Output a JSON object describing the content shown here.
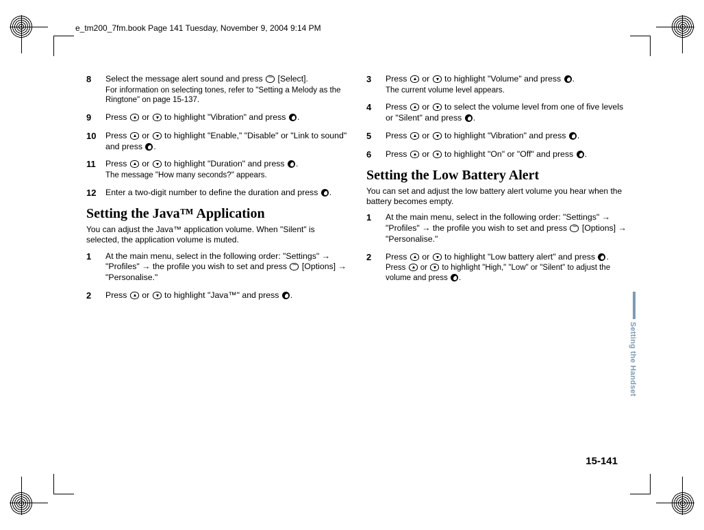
{
  "doc_header": "e_tm200_7fm.book  Page 141  Tuesday, November 9, 2004  9:14 PM",
  "side_tab": "Setting the Handset",
  "page_number": "15-141",
  "left": {
    "steps_a": [
      {
        "n": "8",
        "text_a": "Select the message alert sound and press ",
        "text_b": " [Select].",
        "sub": "For information on selecting tones, refer to \"Setting a Melody as the Ringtone\" on page 15-137."
      },
      {
        "n": "9",
        "text_a": "Press ",
        "mid": " or ",
        "text_b": " to highlight \"Vibration\" and press ",
        "text_c": "."
      },
      {
        "n": "10",
        "text_a": "Press ",
        "mid": " or ",
        "text_b": " to highlight \"Enable,\" \"Disable\" or \"Link to sound\" and press ",
        "text_c": "."
      },
      {
        "n": "11",
        "text_a": "Press ",
        "mid": " or ",
        "text_b": " to highlight \"Duration\" and press ",
        "text_c": ".",
        "sub": "The message \"How many seconds?\" appears."
      },
      {
        "n": "12",
        "text_a": "Enter a two-digit number to define the duration and press ",
        "text_c": "."
      }
    ],
    "heading": "Setting the Java™ Application",
    "intro": "You can adjust the Java™ application volume. When \"Silent\" is selected, the application volume is muted.",
    "steps_b": [
      {
        "n": "1",
        "text": "At the main menu, select in the following order: \"Settings\" → \"Profiles\" → the profile you wish to set and press ",
        "text2": " [Options] → \"Personalise.\""
      },
      {
        "n": "2",
        "text_a": "Press ",
        "mid": " or ",
        "text_b": " to highlight \"Java™\" and press ",
        "text_c": "."
      }
    ]
  },
  "right": {
    "steps_a": [
      {
        "n": "3",
        "text_a": "Press ",
        "mid": " or ",
        "text_b": " to highlight \"Volume\" and press ",
        "text_c": ".",
        "sub": "The current volume level appears."
      },
      {
        "n": "4",
        "text_a": "Press ",
        "mid": " or ",
        "text_b": " to select the volume level from one of five levels or \"Silent\" and press ",
        "text_c": "."
      },
      {
        "n": "5",
        "text_a": "Press ",
        "mid": " or ",
        "text_b": " to highlight \"Vibration\" and press ",
        "text_c": "."
      },
      {
        "n": "6",
        "text_a": "Press ",
        "mid": " or ",
        "text_b": " to highlight \"On\" or \"Off\" and press ",
        "text_c": "."
      }
    ],
    "heading": "Setting the Low Battery Alert",
    "intro": "You can set and adjust the low battery alert volume you hear when the battery becomes empty.",
    "steps_b": [
      {
        "n": "1",
        "text": "At the main menu, select in the following order: \"Settings\" → \"Profiles\" → the profile you wish to set and press ",
        "text2": " [Options] → \"Personalise.\""
      },
      {
        "n": "2",
        "text_a": "Press ",
        "mid": " or ",
        "text_b": " to highlight \"Low battery alert\" and press ",
        "text_c": ".",
        "sub_a": "Press ",
        "sub_mid": " or ",
        "sub_b": " to highlight \"High,\" \"Low\" or \"Silent\" to adjust the volume and press ",
        "sub_c": "."
      }
    ]
  }
}
